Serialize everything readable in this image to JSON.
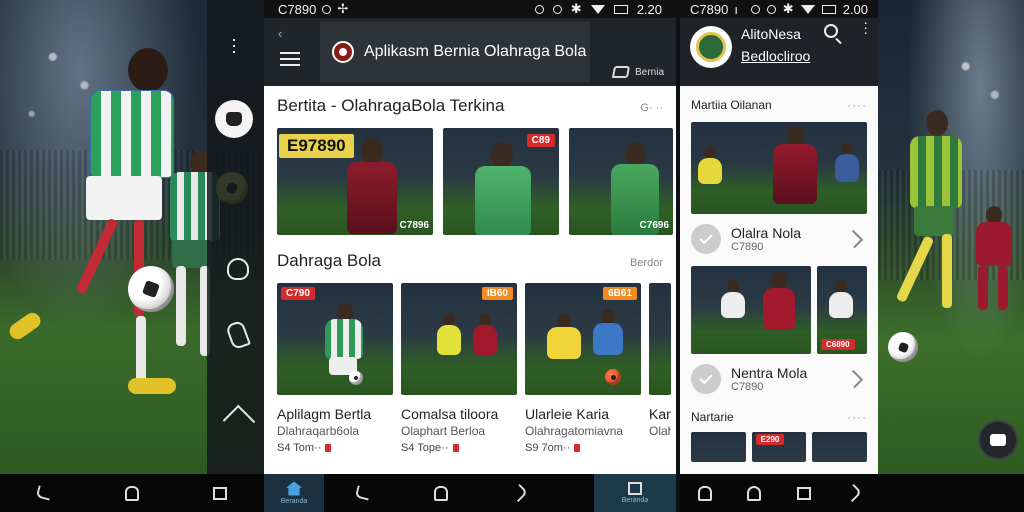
{
  "center_app": {
    "status": {
      "time": "C7890",
      "clock": "2.20"
    },
    "header": {
      "back_glyph": "‹",
      "title": "Aplikasm Bernia Olahraga Bola",
      "action_label": "Bernia"
    },
    "section1": {
      "title": "Bertita - OlahragaBola Terkina",
      "more": "G· ··",
      "cards": [
        {
          "tag": "E97890",
          "tag_style": "yellow",
          "caption": "C7896"
        },
        {
          "tag": "C89",
          "tag_style": "red",
          "caption": ""
        },
        {
          "tag": "",
          "tag_style": "",
          "caption": "C7696"
        }
      ]
    },
    "section2": {
      "title": "Dahraga Bola",
      "more": "Berdor",
      "cards": [
        {
          "tag": "C790",
          "tag_style": "redl",
          "title": "Aplilagm Bertla",
          "subtitle": "Dlahraqarb6ola",
          "meta": "S4 Tom··"
        },
        {
          "tag": "IB60",
          "tag_style": "orange",
          "title": "Comalsa tiloora",
          "subtitle": "Olaphart Berloa",
          "meta": "S4 Tope··"
        },
        {
          "tag": "6B61",
          "tag_style": "orange",
          "title": "Ularleie Karia",
          "subtitle": "Olahragatomiavna",
          "meta": "S9 7om··"
        },
        {
          "tag": "",
          "tag_style": "",
          "title": "Kan",
          "subtitle": "Olah",
          "meta": ""
        }
      ]
    },
    "nav": {
      "home_label": "Beranda",
      "last_label": "Beranda"
    }
  },
  "right_app": {
    "status": {
      "time": "C7890",
      "clock": "2.00"
    },
    "header": {
      "name": "AlitoNesa",
      "subtitle": "Bedlocliroo"
    },
    "section1": {
      "title": "Martiia Oilanan",
      "more": "····"
    },
    "items": [
      {
        "title": "Olalra Nola",
        "subtitle": "C7890"
      },
      {
        "title": "Nentra Mola",
        "subtitle": "C7890"
      }
    ],
    "grid_tag": "C6890",
    "section2": {
      "title": "Nartarie",
      "more": "····"
    },
    "mini_tag": "E290"
  },
  "colors": {
    "accent": "#d62b2b",
    "tag_yellow": "#e8d24a",
    "tag_orange": "#f08a22",
    "header_dark": "#20252a",
    "home_tab": "#4aa3e0"
  }
}
